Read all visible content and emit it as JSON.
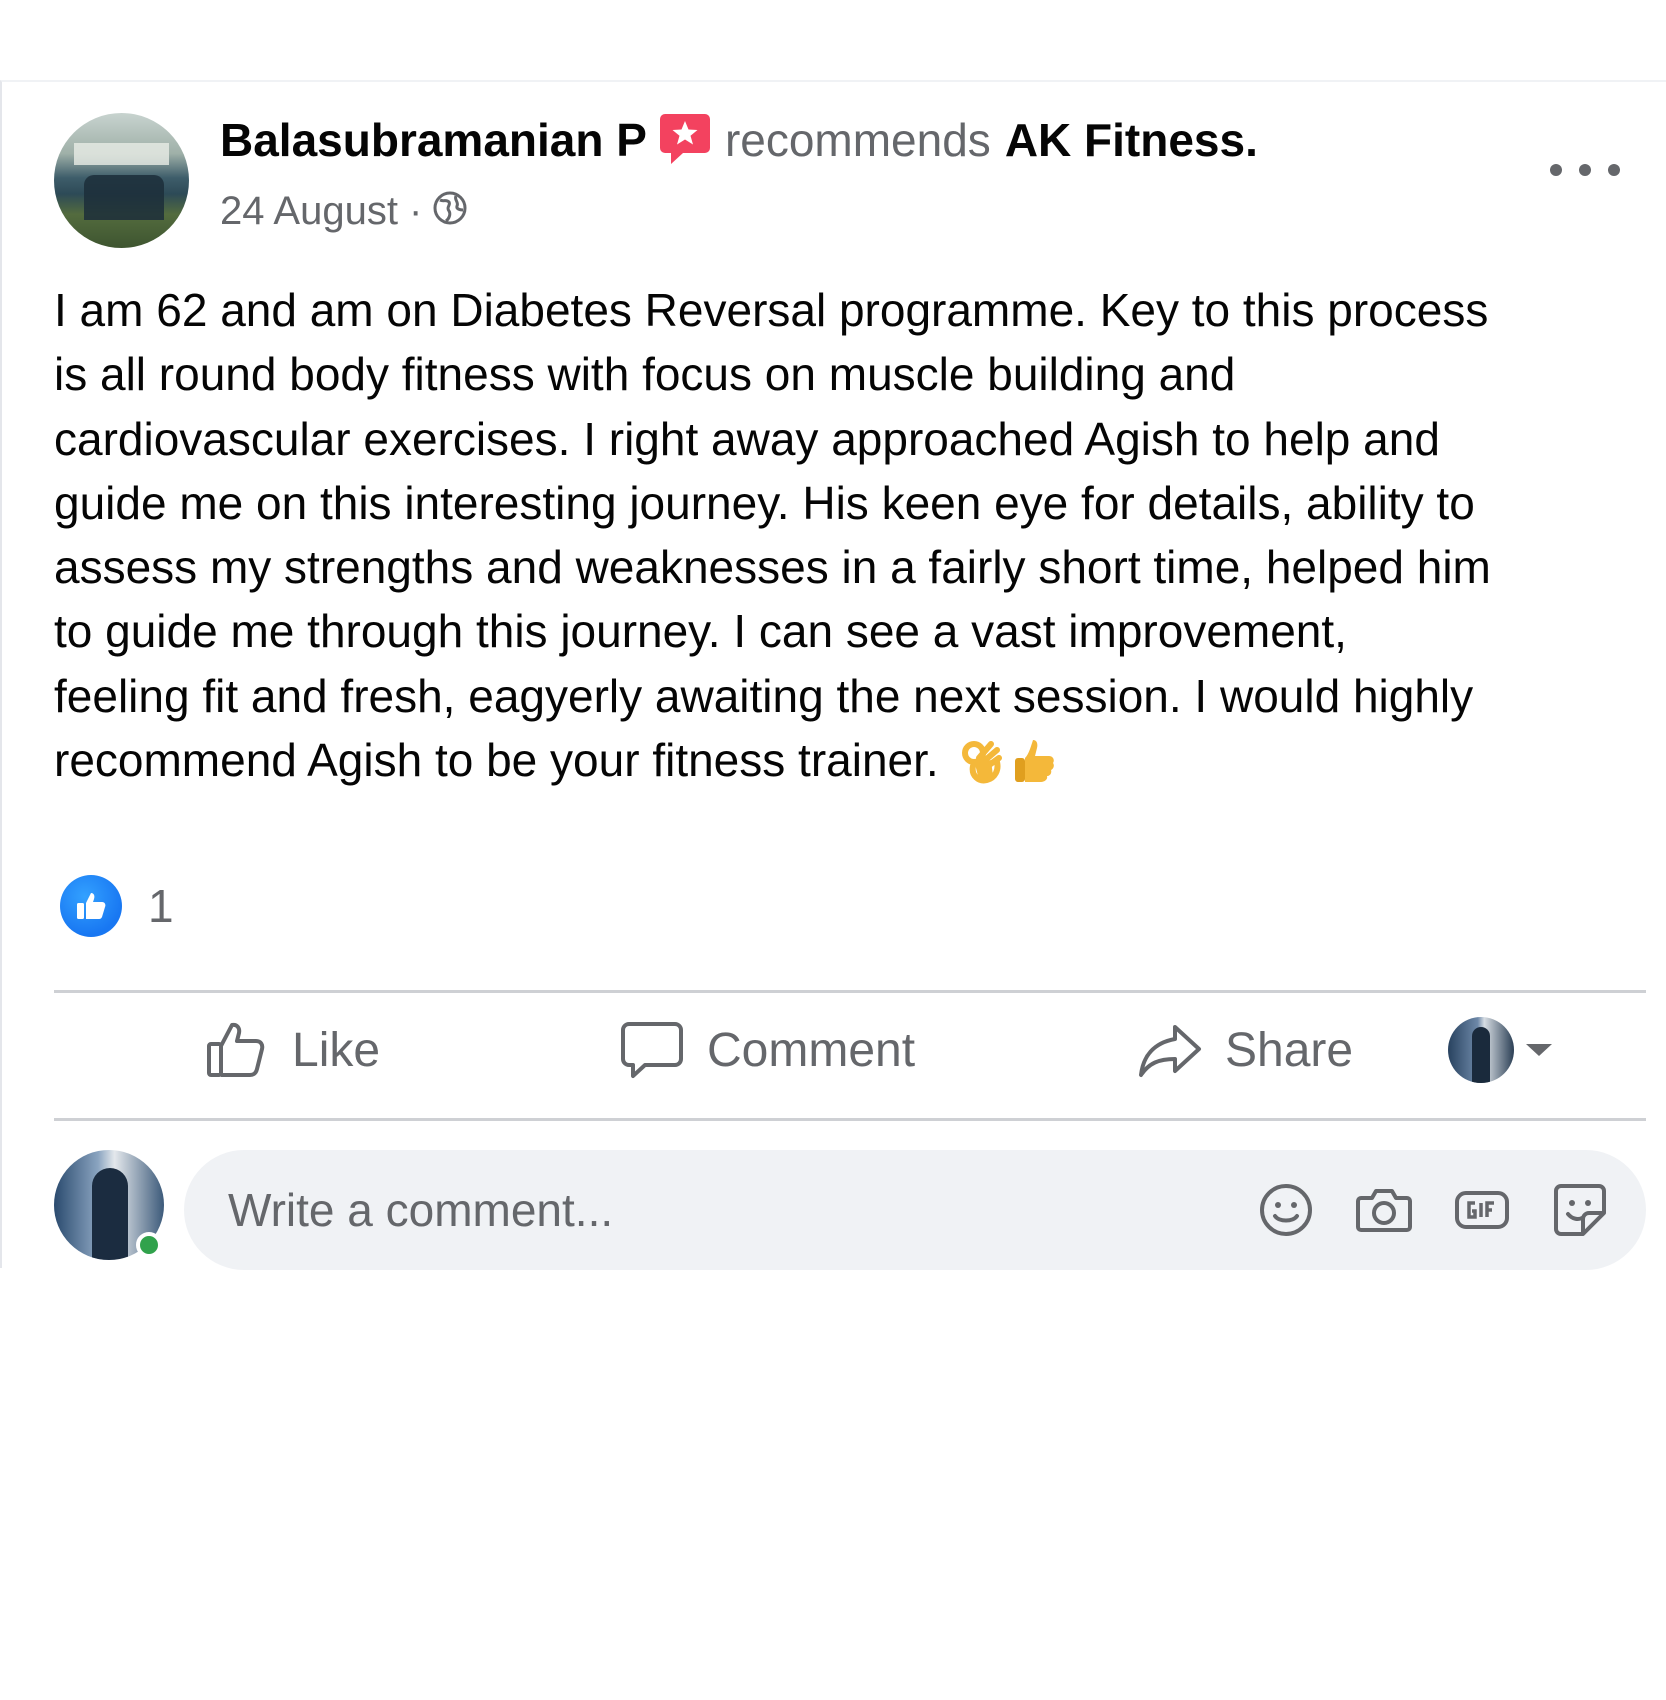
{
  "post": {
    "author": "Balasubramanian P",
    "action": "recommends",
    "page": "AK Fitness.",
    "date": "24 August ·",
    "body": "I am 62 and am on Diabetes Reversal programme. Key to this process\nis all round body fitness with focus on muscle building and\ncardiovascular exercises. I right away approached Agish to help and\nguide me on this interesting journey. His keen eye for details, ability to\nassess my strengths and weaknesses in a fairly short time, helped him\nto guide me through this journey. I can see a vast improvement,\nfeeling fit and fresh, eagyerly awaiting the next session. I would highly\nrecommend Agish to be your fitness trainer. ",
    "emojis": [
      "👌",
      "👍"
    ]
  },
  "reactions": {
    "count": "1",
    "icon": "like-icon"
  },
  "actions": {
    "like": "Like",
    "comment": "Comment",
    "share": "Share"
  },
  "comment_box": {
    "placeholder": "Write a comment..."
  },
  "icons": {
    "recommend": "recommend-star-icon",
    "privacy": "globe-icon",
    "more": "more-options-icon",
    "tools": [
      "emoji-icon",
      "camera-icon",
      "gif-icon",
      "sticker-icon"
    ]
  },
  "colors": {
    "accent": "#1877f2",
    "recommend_badge": "#f3425f",
    "secondary_text": "#65676b",
    "online": "#31a24c",
    "input_bg": "#f0f2f5"
  }
}
